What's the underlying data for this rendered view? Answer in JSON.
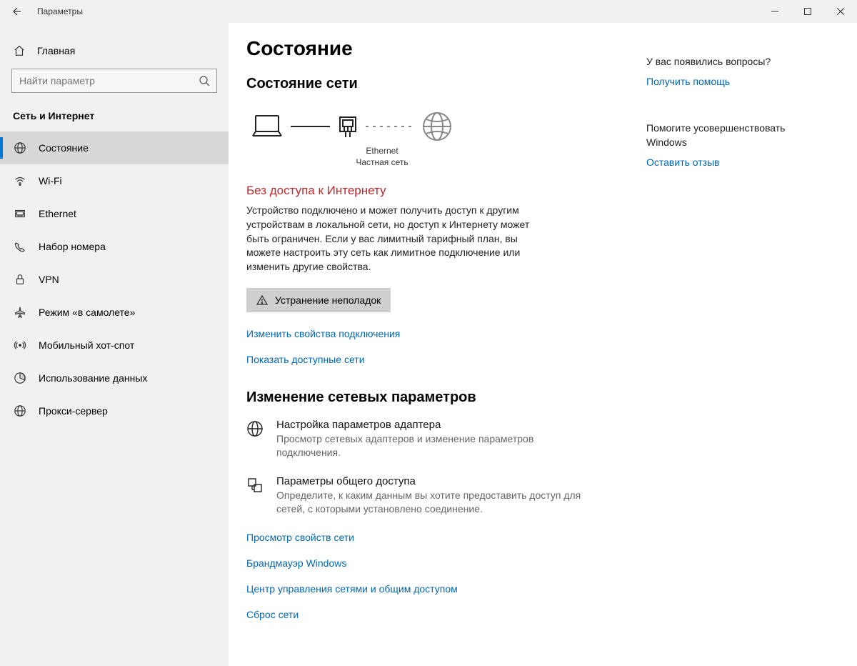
{
  "window": {
    "title": "Параметры"
  },
  "sidebar": {
    "home": "Главная",
    "search_placeholder": "Найти параметр",
    "section": "Сеть и Интернет",
    "items": [
      {
        "label": "Состояние"
      },
      {
        "label": "Wi-Fi"
      },
      {
        "label": "Ethernet"
      },
      {
        "label": "Набор номера"
      },
      {
        "label": "VPN"
      },
      {
        "label": "Режим «в самолете»"
      },
      {
        "label": "Мобильный хот-спот"
      },
      {
        "label": "Использование данных"
      },
      {
        "label": "Прокси-сервер"
      }
    ]
  },
  "main": {
    "title": "Состояние",
    "net_status_heading": "Состояние сети",
    "diagram": {
      "conn_label1": "Ethernet",
      "conn_label2": "Частная сеть"
    },
    "alert": "Без доступа к Интернету",
    "desc": "Устройство подключено и может получить доступ к другим устройствам в локальной сети, но доступ к Интернету может быть ограничен. Если у вас лимитный тарифный план, вы можете настроить эту сеть как лимитное подключение или изменить другие свойства.",
    "troubleshoot_btn": "Устранение неполадок",
    "link_change_props": "Изменить свойства подключения",
    "link_show_networks": "Показать доступные сети",
    "change_heading": "Изменение сетевых параметров",
    "options": [
      {
        "title": "Настройка параметров адаптера",
        "desc": "Просмотр сетевых адаптеров и изменение параметров подключения."
      },
      {
        "title": "Параметры общего доступа",
        "desc": "Определите, к каким данным вы хотите предоставить доступ для сетей, с которыми установлено соединение."
      }
    ],
    "more_links": [
      "Просмотр свойств сети",
      "Брандмауэр Windows",
      "Центр управления сетями и общим доступом",
      "Сброс сети"
    ]
  },
  "right": {
    "faq_heading": "У вас появились вопросы?",
    "help_link": "Получить помощь",
    "improve_heading": "Помогите усовершенствовать Windows",
    "feedback_link": "Оставить отзыв"
  }
}
